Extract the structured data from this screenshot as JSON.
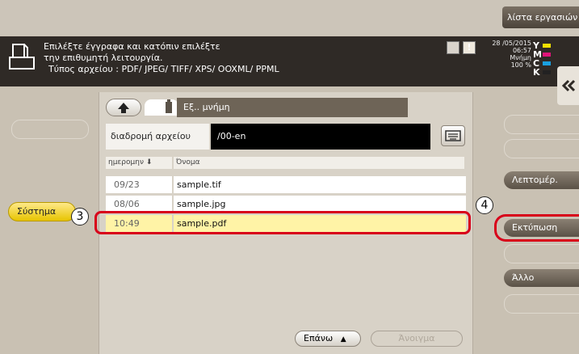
{
  "topbar": {
    "job_list_label": "λίστα εργασιών"
  },
  "header": {
    "message_line1": "Επιλέξτε έγγραφα και κατόπιν επιλέξτε",
    "message_line2": "την επιθυμητή λειτουργία.",
    "message_line3": "Τύπος αρχείου      : PDF/ JPEG/ TIFF/ XPS/ OOXML/ PPML",
    "date": "28 /05/2015",
    "time": "06:57",
    "memory_label": "Μνήμη",
    "memory_value": "100 %",
    "toner": [
      {
        "letter": "Y",
        "color": "#f2e000"
      },
      {
        "letter": "M",
        "color": "#e0147a"
      },
      {
        "letter": "C",
        "color": "#1aa0e0"
      },
      {
        "letter": "K",
        "color": "#222222"
      }
    ]
  },
  "left_panel": {
    "system_label": "Σύστημα"
  },
  "main": {
    "location_title": "Εξ.. μνήμη",
    "path_label": "διαδρομή αρχείου",
    "path_value": "/00-en",
    "column_date": "ημερομην ⬇",
    "column_name": "Όνομα",
    "files": [
      {
        "date": "09/23",
        "name": "sample.tif",
        "selected": false
      },
      {
        "date": "08/06",
        "name": "sample.jpg",
        "selected": false
      },
      {
        "date": "10:49",
        "name": "sample.pdf",
        "selected": true
      }
    ],
    "up_label": "Επάνω",
    "open_label": "Άνοιγμα"
  },
  "right_panel": {
    "details_label": "Λεπτομέρ.",
    "print_label": "Εκτύπωση",
    "other_label": "Άλλο"
  },
  "callouts": {
    "step3": "3",
    "step4": "4"
  },
  "colors": {
    "accent_highlight": "#d8001a",
    "selected_row": "#fff3a6",
    "system_button": "#f2d21a"
  }
}
